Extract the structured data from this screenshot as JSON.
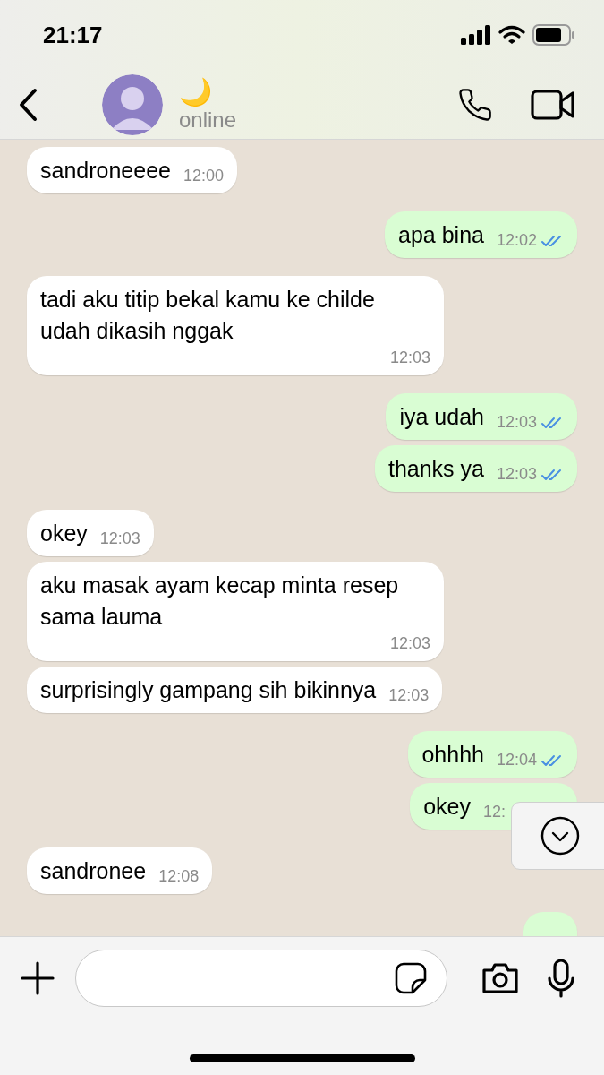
{
  "status_bar": {
    "time": "21:17"
  },
  "header": {
    "contact_name": "🌙",
    "status": "online"
  },
  "messages": [
    {
      "kind": "in",
      "text": "sandroneeee",
      "time": "12:00"
    },
    {
      "kind": "out",
      "text": "apa bina",
      "time": "12:02",
      "read": true
    },
    {
      "kind": "in",
      "text": "tadi aku titip bekal kamu ke childe udah dikasih nggak",
      "time": "12:03"
    },
    {
      "kind": "out",
      "text": "iya udah",
      "time": "12:03",
      "read": true
    },
    {
      "kind": "out",
      "text": "thanks ya",
      "time": "12:03",
      "read": true
    },
    {
      "kind": "in",
      "text": "okey",
      "time": "12:03"
    },
    {
      "kind": "in",
      "text": "aku masak ayam kecap minta resep sama lauma",
      "time": "12:03"
    },
    {
      "kind": "in",
      "text": "surprisingly gampang sih bikinnya",
      "time": "12:03"
    },
    {
      "kind": "out",
      "text": "ohhhh",
      "time": "12:04",
      "read": true
    },
    {
      "kind": "out",
      "text": "okey",
      "time": "12:"
    },
    {
      "kind": "in",
      "text": "sandronee",
      "time": "12:08"
    },
    {
      "kind": "out"
    }
  ]
}
